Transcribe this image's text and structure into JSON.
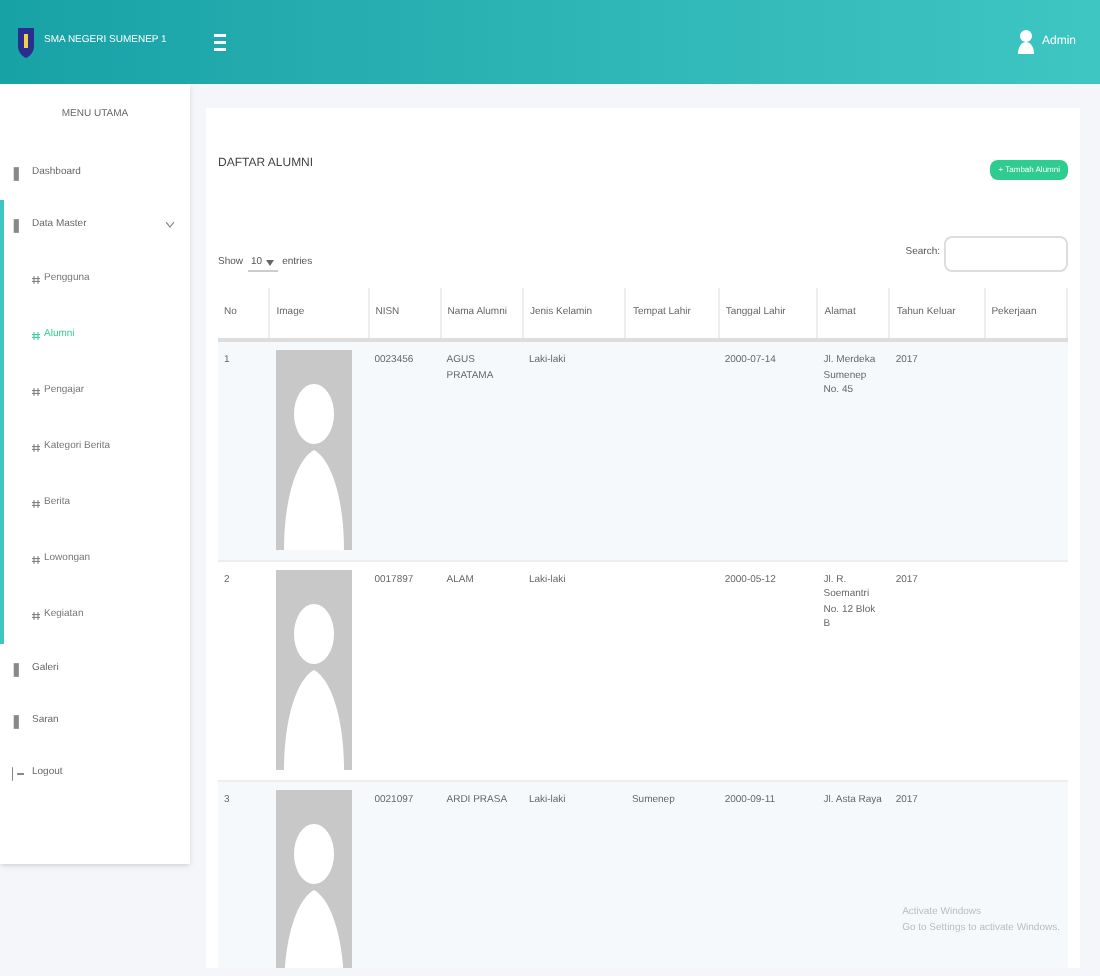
{
  "header": {
    "brand": "SMA NEGERI SUMENEP 1",
    "user": "Admin"
  },
  "sidebar": {
    "heading": "MENU UTAMA",
    "items": [
      {
        "label": "Dashboard",
        "selected": false,
        "expanded": false
      },
      {
        "label": "Data Master",
        "selected": false,
        "expanded": true,
        "children": [
          {
            "label": "Pengguna",
            "selected": false
          },
          {
            "label": "Alumni",
            "selected": true
          },
          {
            "label": "Pengajar",
            "selected": false
          },
          {
            "label": "Kategori Berita",
            "selected": false
          },
          {
            "label": "Berita",
            "selected": false
          },
          {
            "label": "Lowongan",
            "selected": false
          },
          {
            "label": "Kegiatan",
            "selected": false
          }
        ]
      },
      {
        "label": "Galeri",
        "selected": false,
        "expanded": false
      },
      {
        "label": "Saran",
        "selected": false,
        "expanded": false
      },
      {
        "label": "Logout",
        "selected": false,
        "expanded": false
      }
    ]
  },
  "page": {
    "title": "DAFTAR ALUMNI",
    "add_button": "+ Tambah Alumni",
    "show_label": "Show",
    "show_value": "10",
    "entries_label": "entries",
    "search_label": "Search:"
  },
  "table": {
    "columns": [
      "No",
      "Image",
      "NISN",
      "Nama Alumni",
      "Jenis Kelamin",
      "Tempat Lahir",
      "Tanggal Lahir",
      "Alamat",
      "Tahun Keluar",
      "Pekerjaan"
    ],
    "rows": [
      {
        "no": "1",
        "nisn": "0023456",
        "name": "AGUS PRATAMA",
        "gender": "Laki-laki",
        "birthdate": "2000-07-14",
        "address": "Jl. Merdeka Sumenep No. 45",
        "year": "2017"
      },
      {
        "no": "2",
        "nisn": "0017897",
        "name": "ALAM",
        "gender": "Laki-laki",
        "birthdate": "2000-05-12",
        "address": "Jl. R. Soemantri No. 12 Blok B",
        "year": "2017"
      },
      {
        "no": "3",
        "nisn": "0021097",
        "name": "ARDI PRASA",
        "gender": "Laki-laki",
        "birthplace": "Sumenep",
        "birthdate": "2000-09-11",
        "address": "Jl. Asta Raya",
        "year": "2017"
      }
    ]
  },
  "os_notice": {
    "title": "Activate Windows",
    "text": "Go to Settings to activate Windows."
  }
}
